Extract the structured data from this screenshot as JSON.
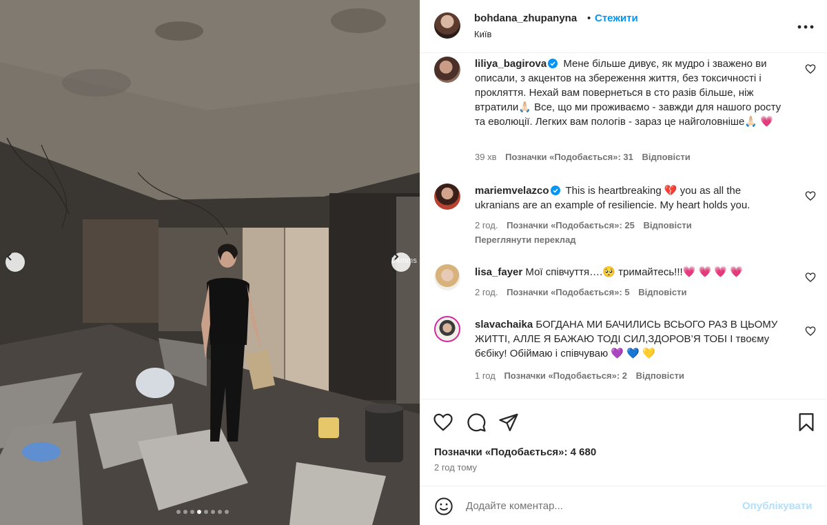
{
  "post": {
    "author": "bohdana_zhupanyna",
    "separator": "•",
    "follow_label": "Стежити",
    "location": "Київ",
    "likes_label": "Позначки «Подобається»: 4 680",
    "time": "2 год тому"
  },
  "carousel": {
    "watermark": "b4mms",
    "dot_count": 8,
    "active_dot": 3
  },
  "comments": [
    {
      "user": "liliya_bagirova",
      "verified": true,
      "text": "Мене більше дивує, як мудро і зважено ви описали, з акцентов на збереження життя, без токсичності і прокляття. Нехай вам повернеться в сто разів більше, ніж втратили🙏🏻 Все, що ми проживаємо - завжди для нашого росту та еволюції. Легких вам пологів - зараз це найголовніше🙏🏻 💗",
      "time": "39 хв",
      "likes": "Позначки «Подобається»: 31",
      "reply": "Відповісти",
      "translate": ""
    },
    {
      "user": "mariemvelazco",
      "verified": true,
      "text": "This is heartbreaking 💔  you as all the ukranians are an example of resiliencie. My heart holds you.",
      "time": "2 год.",
      "likes": "Позначки «Подобається»: 25",
      "reply": "Відповісти",
      "translate": "Переглянути переклад"
    },
    {
      "user": "lisa_fayer",
      "verified": false,
      "text": "Мої співчуття….🥺  тримайтесь!!!💗 💗 💗 💗",
      "time": "2 год.",
      "likes": "Позначки «Подобається»: 5",
      "reply": "Відповісти",
      "translate": ""
    },
    {
      "user": "slavachaika",
      "verified": false,
      "text": "БОГДАНА МИ БАЧИЛИСЬ ВСЬОГО РАЗ В ЦЬОМУ ЖИТТІ, АЛЛЕ Я БАЖАЮ ТОДІ СИЛ,ЗДОРОВ’Я ТОБІ І твоєму бєбіку! Обіймаю і співчуваю  💜 💙 💛",
      "time": "1 год",
      "likes": "Позначки «Подобається»: 2",
      "reply": "Відповісти",
      "translate": ""
    }
  ],
  "comment_box": {
    "placeholder": "Додайте коментар...",
    "publish_label": "Опублікувати"
  },
  "colors": {
    "link_blue": "#0095f6",
    "publish_disabled": "#b2dffc",
    "muted_text": "#737373",
    "verified_blue": "#0095f6"
  },
  "icons": [
    "chevron-left-icon",
    "chevron-right-icon",
    "more-icon",
    "verified-icon",
    "heart-icon",
    "comment-icon",
    "share-icon",
    "bookmark-icon",
    "emoji-icon"
  ]
}
